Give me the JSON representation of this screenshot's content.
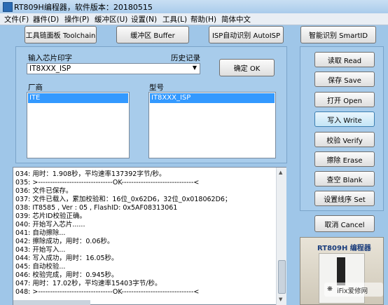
{
  "window": {
    "title": "RT809H编程器，软件版本：20180515"
  },
  "menu": [
    "文件(F)",
    "器件(D)",
    "操作(P)",
    "缓冲区(U)",
    "设置(N)",
    "工具(L)",
    "帮助(H)",
    "简体中文"
  ],
  "toolbar": {
    "toolchain": "工具链面板 Toolchain",
    "buffer": "缓冲区 Buffer",
    "autoisp": "ISP自动识别 AutoISP",
    "smartid": "智能识别 SmartID"
  },
  "chip": {
    "input_label": "输入芯片印字",
    "history_label": "历史记录",
    "value": "IT8XXX_ISP",
    "ok_button": "确定 OK",
    "vendor_label": "厂商",
    "model_label": "型号",
    "vendor_selected": "ITE",
    "model_selected": "IT8XXX_ISP"
  },
  "actions": {
    "read": "读取 Read",
    "save": "保存 Save",
    "open": "打开 Open",
    "write": "写入 Write",
    "verify": "校验 Verify",
    "erase": "擦除 Erase",
    "blank": "查空 Blank",
    "set": "设置线序 Set",
    "cancel": "取消 Cancel"
  },
  "log": [
    "034: 用时：1.908秒，平均速率137392字节/秒。",
    "035: >-------------------------------OK------------------------------<",
    "036: 文件已保存。",
    "037: 文件已载入，累加校验和：16位_0x62D6，32位_0x018062D6；",
    "038: IT8585 , Ver : 05 , FlashID: 0x5AF08313061",
    "039: 芯片ID校验正确。",
    "040: 开始写入芯片......",
    "041: 自动擦除...",
    "042: 擦除成功，用时：0.06秒。",
    "043: 开始写入...",
    "044: 写入成功，用时：16.05秒。",
    "045: 自动校验...",
    "046: 校验完成，用时：0.945秒。",
    "047: 用时：17.02秒，平均速率15403字节/秒。",
    "048: >-------------------------------OK------------------------------<"
  ],
  "product": {
    "title": "RT809H 编程器",
    "watermark": "iFix爱修网"
  }
}
